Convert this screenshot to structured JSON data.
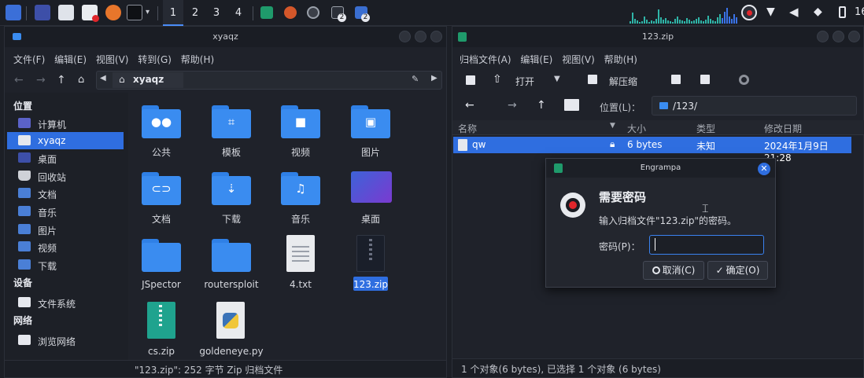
{
  "panel": {
    "workspaces": [
      "1",
      "2",
      "3",
      "4"
    ],
    "active_workspace": "1",
    "clock_partial": "16",
    "badge_count": "2"
  },
  "file_manager": {
    "title": "xyaqz",
    "menu": [
      "文件(F)",
      "编辑(E)",
      "视图(V)",
      "转到(G)",
      "帮助(H)"
    ],
    "path_segment": "xyaqz",
    "sidebar": {
      "places_heading": "位置",
      "places": [
        "计算机",
        "xyaqz",
        "桌面",
        "回收站",
        "文档",
        "音乐",
        "图片",
        "视频",
        "下载"
      ],
      "devices_heading": "设备",
      "devices": [
        "文件系统"
      ],
      "network_heading": "网络",
      "network": [
        "浏览网络"
      ]
    },
    "items": [
      "公共",
      "模板",
      "视频",
      "图片",
      "文档",
      "下载",
      "音乐",
      "桌面",
      "JSpector",
      "routersploit",
      "4.txt",
      "123.zip",
      "cs.zip",
      "goldeneye.py"
    ],
    "status": "\"123.zip\": 252 字节 Zip 归档文件"
  },
  "archive": {
    "title": "123.zip",
    "menu": [
      "归档文件(A)",
      "编辑(E)",
      "视图(V)",
      "帮助(H)"
    ],
    "toolbar": {
      "open": "打开",
      "extract": "解压缩"
    },
    "location_label": "位置(L)：",
    "location_value": "/123/",
    "columns": [
      "名称",
      "大小",
      "类型",
      "修改日期"
    ],
    "rows": [
      {
        "name": "qw",
        "size": "6 bytes",
        "type": "未知",
        "date": "2024年1月9日 21:28"
      }
    ],
    "status": "1 个对象(6 bytes), 已选择 1 个对象 (6 bytes)"
  },
  "dialog": {
    "title": "Engrampa",
    "heading": "需要密码",
    "message": "输入归档文件\"123.zip\"的密码。",
    "password_label": "密码(P)：",
    "password_value": "",
    "cancel": "取消(C)",
    "ok": "确定(O)"
  },
  "colors": {
    "accent": "#2f6ee0",
    "folder": "#3a8cf0",
    "background": "#1f222a"
  }
}
